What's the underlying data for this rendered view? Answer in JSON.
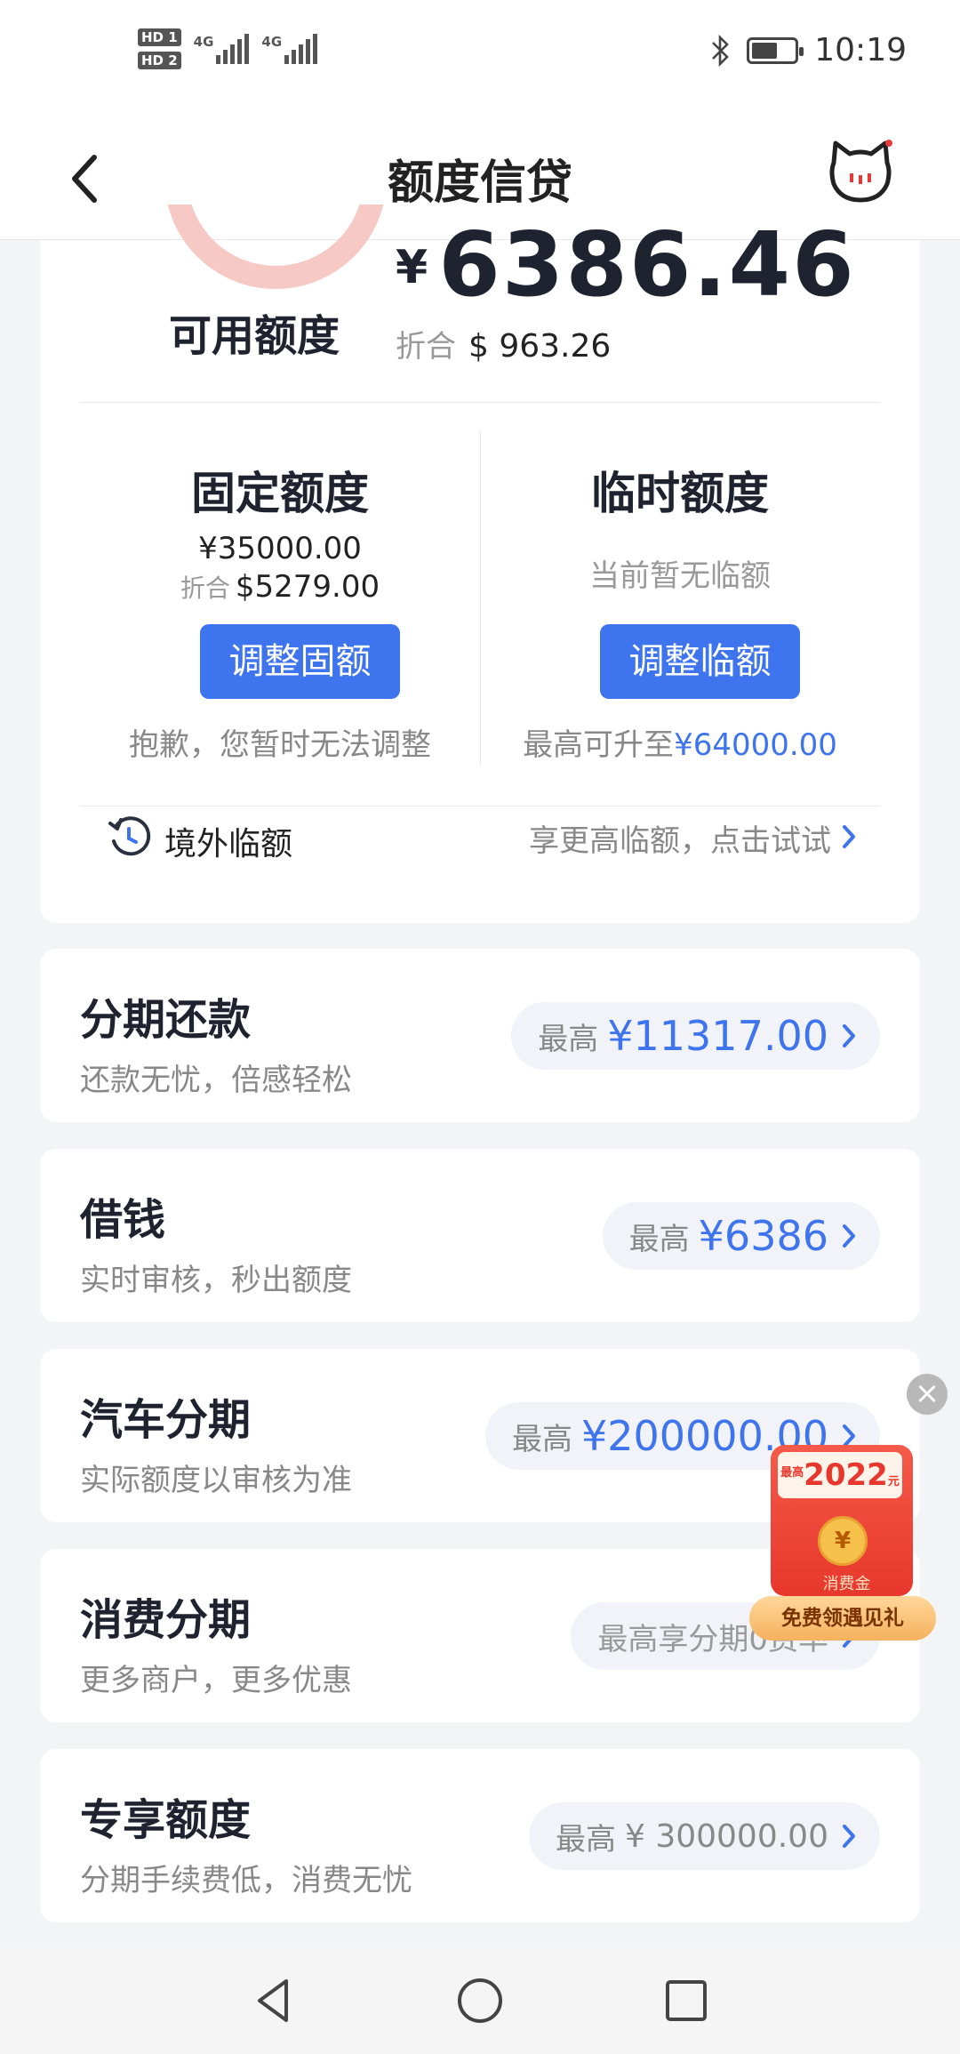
{
  "status_bar": {
    "hd1": "HD 1",
    "hd2": "HD 2",
    "sig1_label": "4G",
    "sig2_label": "4G",
    "time": "10:19"
  },
  "header": {
    "title": "额度信贷"
  },
  "credit": {
    "available_label": "可用额度",
    "currency_symbol": "¥",
    "available_amount": "6386.46",
    "approx_prefix": "折合",
    "approx_amount": "$ 963.26",
    "fixed": {
      "title": "固定额度",
      "amount": "¥35000.00",
      "approx_prefix": "折合",
      "approx_amount": "$5279.00",
      "button": "调整固额",
      "note": "抱歉，您暂时无法调整"
    },
    "temporary": {
      "title": "临时额度",
      "status": "当前暂无临额",
      "button": "调整临额",
      "note_prefix": "最高可升至",
      "note_amount": "¥64000.00"
    },
    "overseas": {
      "label": "境外临额",
      "link": "享更高临额，点击试试"
    }
  },
  "products": [
    {
      "title": "分期还款",
      "subtitle": "还款无忧，倍感轻松",
      "prefix": "最高",
      "value": "¥11317.00"
    },
    {
      "title": "借钱",
      "subtitle": "实时审核，秒出额度",
      "prefix": "最高",
      "value": "¥6386"
    },
    {
      "title": "汽车分期",
      "subtitle": "实际额度以审核为准",
      "prefix": "最高",
      "value": "¥200000.00"
    },
    {
      "title": "消费分期",
      "subtitle": "更多商户，更多优惠",
      "prefix": "",
      "value": "最高享分期0费率"
    },
    {
      "title": "专享额度",
      "subtitle": "分期手续费低，消费无忧",
      "prefix": "最高",
      "value": "¥ 300000.00"
    }
  ],
  "promo": {
    "close": "×",
    "top_small_1": "最高",
    "year": "2022",
    "top_small_2": "元",
    "coin": "¥",
    "gold_label": "消费金",
    "banner": "免费领遇见礼"
  },
  "colors": {
    "accent": "#3e74ee",
    "ring": "#f6c9c4",
    "background": "#f3f4f6"
  }
}
